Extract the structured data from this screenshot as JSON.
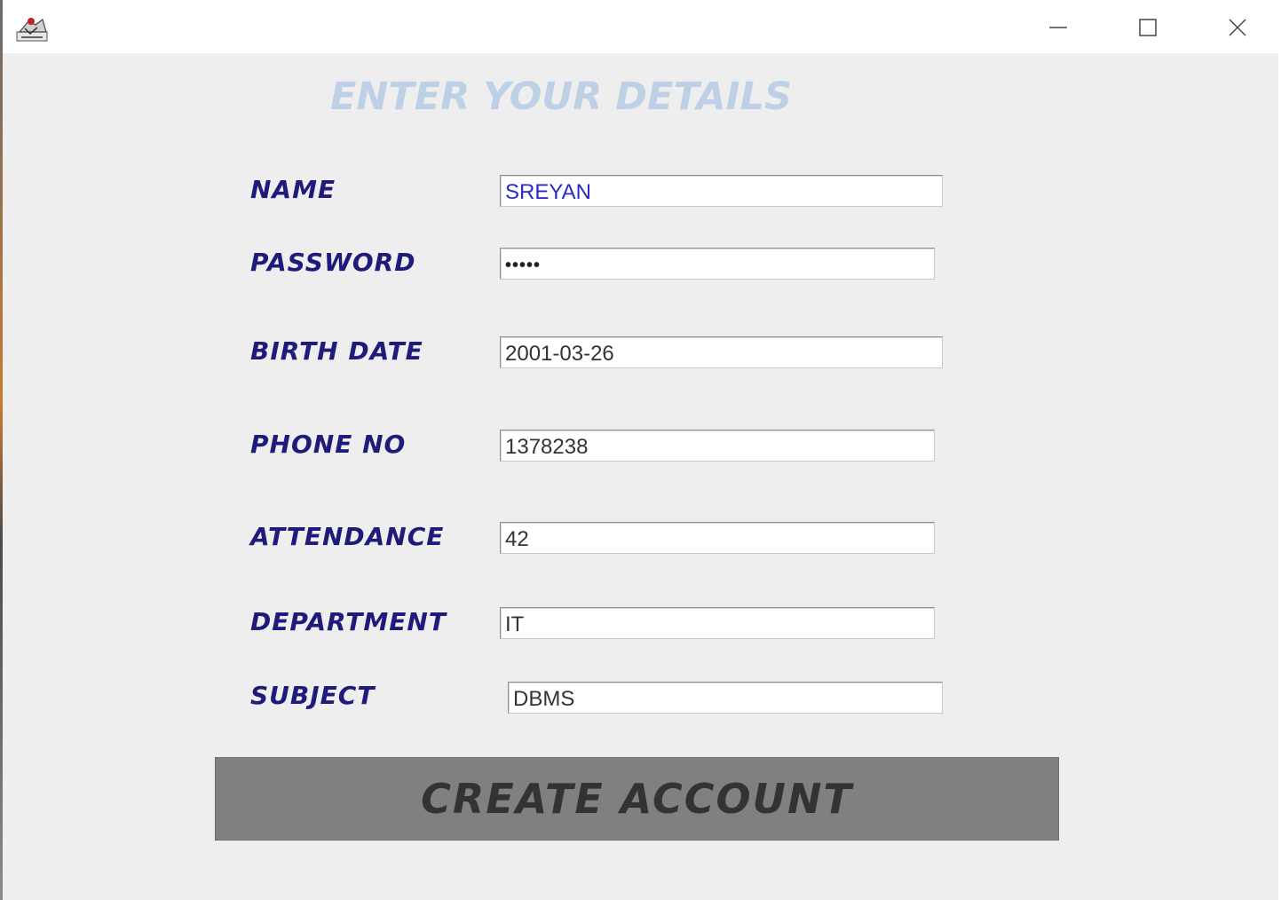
{
  "window": {
    "controls": {
      "minimize_icon": "minimize-icon",
      "maximize_icon": "maximize-icon",
      "close_icon": "close-icon"
    },
    "app_icon": "java-app-icon"
  },
  "form": {
    "heading": "ENTER YOUR DETAILS",
    "fields": [
      {
        "label": "NAME",
        "value": "SREYAN"
      },
      {
        "label": "PASSWORD",
        "value": "•••••"
      },
      {
        "label": "BIRTH DATE",
        "value": "2001-03-26"
      },
      {
        "label": "PHONE NO",
        "value": "1378238"
      },
      {
        "label": "ATTENDANCE",
        "value": "42"
      },
      {
        "label": "DEPARTMENT",
        "value": "IT"
      },
      {
        "label": "SUBJECT",
        "value": "DBMS"
      }
    ],
    "submit_label": "CREATE ACCOUNT"
  },
  "colors": {
    "heading": "#bdd0e6",
    "label": "#1e1b7a",
    "name_value": "#2a2ac8",
    "panel_background": "#eeeeee",
    "button_background": "#808080",
    "button_text": "#333333"
  }
}
